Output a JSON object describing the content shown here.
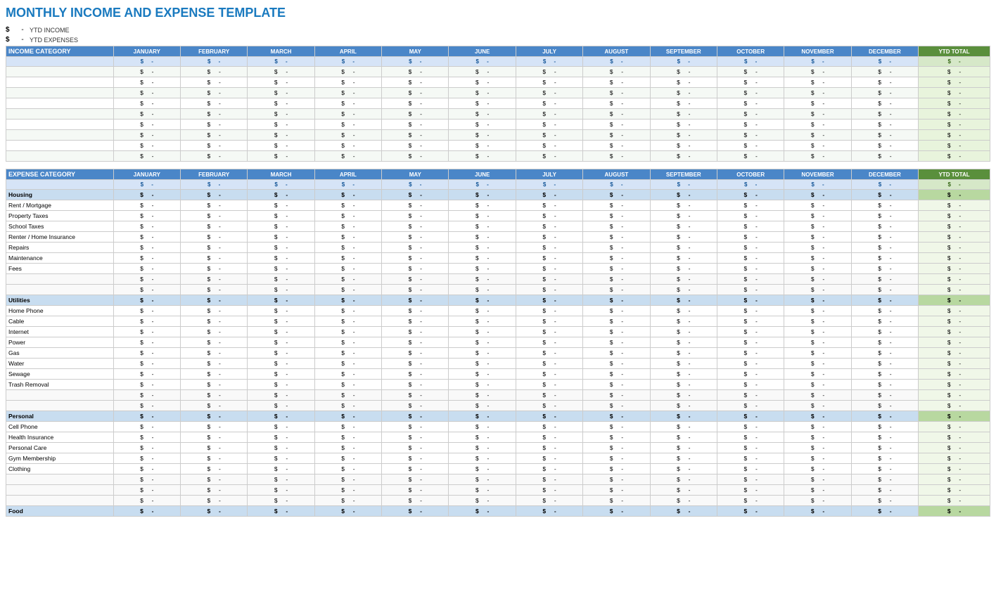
{
  "title": "MONTHLY INCOME AND EXPENSE TEMPLATE",
  "ytd": {
    "income_label": "YTD INCOME",
    "expense_label": "YTD EXPENSES",
    "dollar": "$",
    "dash": "-"
  },
  "months": [
    "JANUARY",
    "FEBRUARY",
    "MARCH",
    "APRIL",
    "MAY",
    "JUNE",
    "JULY",
    "AUGUST",
    "SEPTEMBER",
    "OCTOBER",
    "NOVEMBER",
    "DECEMBER"
  ],
  "ytd_total_label": "YTD TOTAL",
  "income_category_label": "INCOME CATEGORY",
  "expense_category_label": "EXPENSE CATEGORY",
  "income_rows": [
    {
      "label": "",
      "vals": [
        "$",
        "-",
        "$",
        "-",
        "$",
        "-",
        "$",
        "-",
        "$",
        "-",
        "$",
        "-",
        "$",
        "-",
        "$",
        "-",
        "$",
        "-",
        "$",
        "-",
        "$",
        "-",
        "$",
        "-",
        "$",
        "-"
      ]
    },
    {
      "label": "",
      "vals": [
        "$",
        "-",
        "$",
        "-",
        "$",
        "-",
        "$",
        "-",
        "$",
        "-",
        "$",
        "-",
        "$",
        "-",
        "$",
        "-",
        "$",
        "-",
        "$",
        "-",
        "$",
        "-",
        "$",
        "-",
        "$",
        "-"
      ]
    },
    {
      "label": "",
      "vals": [
        "$",
        "-",
        "$",
        "-",
        "$",
        "-",
        "$",
        "-",
        "$",
        "-",
        "$",
        "-",
        "$",
        "-",
        "$",
        "-",
        "$",
        "-",
        "$",
        "-",
        "$",
        "-",
        "$",
        "-",
        "$",
        "-"
      ]
    },
    {
      "label": "",
      "vals": [
        "$",
        "-",
        "$",
        "-",
        "$",
        "-",
        "$",
        "-",
        "$",
        "-",
        "$",
        "-",
        "$",
        "-",
        "$",
        "-",
        "$",
        "-",
        "$",
        "-",
        "$",
        "-",
        "$",
        "-",
        "$",
        "-"
      ]
    },
    {
      "label": "",
      "vals": [
        "$",
        "-",
        "$",
        "-",
        "$",
        "-",
        "$",
        "-",
        "$",
        "-",
        "$",
        "-",
        "$",
        "-",
        "$",
        "-",
        "$",
        "-",
        "$",
        "-",
        "$",
        "-",
        "$",
        "-",
        "$",
        "-"
      ]
    },
    {
      "label": "",
      "vals": [
        "$",
        "-",
        "$",
        "-",
        "$",
        "-",
        "$",
        "-",
        "$",
        "-",
        "$",
        "-",
        "$",
        "-",
        "$",
        "-",
        "$",
        "-",
        "$",
        "-",
        "$",
        "-",
        "$",
        "-",
        "$",
        "-"
      ]
    },
    {
      "label": "",
      "vals": [
        "$",
        "-",
        "$",
        "-",
        "$",
        "-",
        "$",
        "-",
        "$",
        "-",
        "$",
        "-",
        "$",
        "-",
        "$",
        "-",
        "$",
        "-",
        "$",
        "-",
        "$",
        "-",
        "$",
        "-",
        "$",
        "-"
      ]
    },
    {
      "label": "",
      "vals": [
        "$",
        "-",
        "$",
        "-",
        "$",
        "-",
        "$",
        "-",
        "$",
        "-",
        "$",
        "-",
        "$",
        "-",
        "$",
        "-",
        "$",
        "-",
        "$",
        "-",
        "$",
        "-",
        "$",
        "-",
        "$",
        "-"
      ]
    },
    {
      "label": "",
      "vals": [
        "$",
        "-",
        "$",
        "-",
        "$",
        "-",
        "$",
        "-",
        "$",
        "-",
        "$",
        "-",
        "$",
        "-",
        "$",
        "-",
        "$",
        "-",
        "$",
        "-",
        "$",
        "-",
        "$",
        "-",
        "$",
        "-"
      ]
    }
  ],
  "expense_sections": [
    {
      "name": "Housing",
      "items": [
        "Rent / Mortgage",
        "Property Taxes",
        "School Taxes",
        "Renter / Home Insurance",
        "Repairs",
        "Maintenance",
        "Fees",
        "",
        ""
      ]
    },
    {
      "name": "Utilities",
      "items": [
        "Home Phone",
        "Cable",
        "Internet",
        "Power",
        "Gas",
        "Water",
        "Sewage",
        "Trash Removal",
        "",
        ""
      ]
    },
    {
      "name": "Personal",
      "items": [
        "Cell Phone",
        "Health Insurance",
        "Personal Care",
        "Gym Membership",
        "Clothing",
        "",
        "",
        ""
      ]
    },
    {
      "name": "Food",
      "items": []
    }
  ]
}
